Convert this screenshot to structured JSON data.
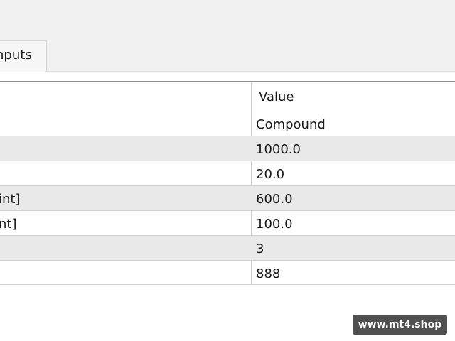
{
  "tab": {
    "label": "nputs"
  },
  "table": {
    "header": {
      "name": "",
      "value": "Value"
    },
    "rows": [
      {
        "name": "",
        "value": "Compound"
      },
      {
        "name": "",
        "value": "1000.0"
      },
      {
        "name": "",
        "value": "20.0"
      },
      {
        "name": "int]",
        "value": "600.0"
      },
      {
        "name": "nt]",
        "value": "100.0"
      },
      {
        "name": "",
        "value": "3"
      },
      {
        "name": "",
        "value": "888"
      }
    ]
  },
  "watermark": {
    "text": "www.mt4.shop"
  }
}
